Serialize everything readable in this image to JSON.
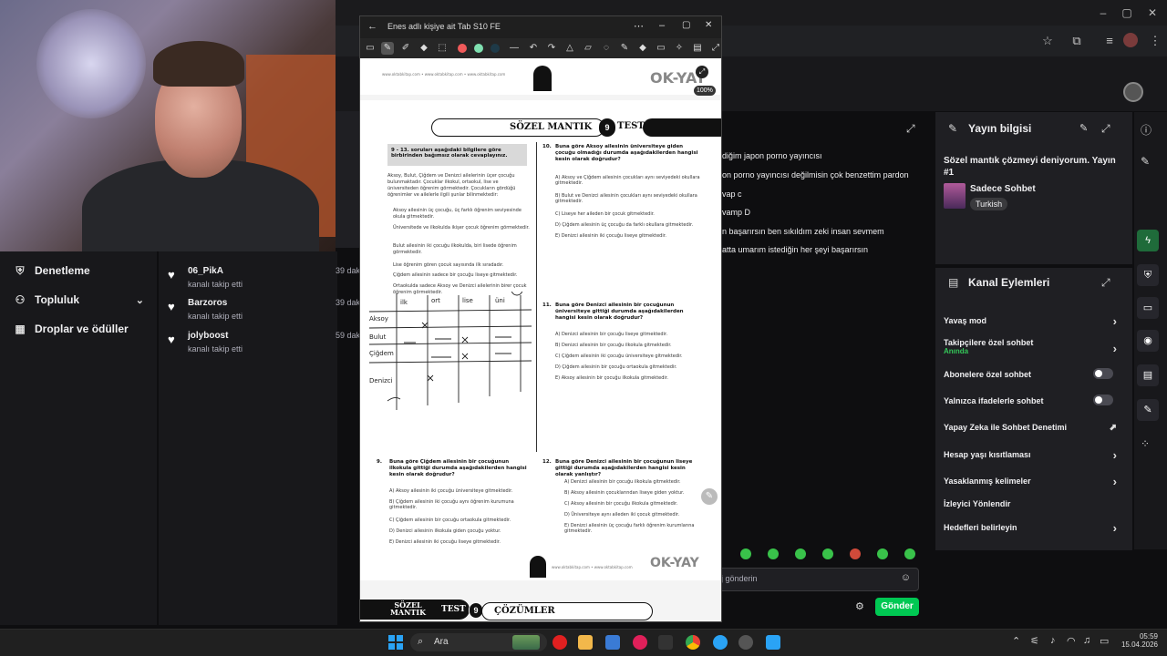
{
  "tablet_window": {
    "title": "Enes adlı kişiye ait Tab S10 FE",
    "zoom": "100%"
  },
  "document": {
    "brand_top": "OK-YAY",
    "brand_bottom": "OK-YAY",
    "header_title": "SÖZEL MANTIK",
    "header_number": "9",
    "header_test": "TEST",
    "footer_title_line1": "SÖZEL",
    "footer_title_line2": "MANTIK",
    "footer_test": "TEST",
    "footer_number": "9",
    "footer_section": "ÇÖZÜMLER",
    "intro_box": "9 - 13. soruları aşağıdaki bilgilere göre birbirinden bağımsız olarak cevaplayınız.",
    "intro_text": "Aksoy, Bulut, Çiğdem ve Denizci ailelerinin üçer çocuğu bulunmaktadır. Çocuklar ilkokul, ortaokul, lise ve üniversiteden öğrenim görmektedir. Çocukların gördüğü öğrenimler ve ailelerle ilgili şunlar bilinmektedir:",
    "bullets": [
      "Aksoy ailesinin üç çocuğu, üç farklı öğrenim seviyesinde okula gitmektedir.",
      "Üniversitede ve ilkokulda ikişer çocuk öğrenim görmektedir.",
      "Bulut ailesinin iki çocuğu ilkokulda, biri lisede öğrenim görmektedir.",
      "Lise öğrenim gören çocuk sayısında ilk sıradadır.",
      "Çiğdem ailesinin sadece bir çocuğu liseye gitmektedir.",
      "Ortaokulda sadece Aksoy ve Denizci ailelerinin birer çocuk öğrenim görmektedir."
    ],
    "grid_rows": [
      "Aksoy",
      "Bulut",
      "Çiğdem",
      "Denizci"
    ],
    "grid_cols": [
      "ilk",
      "ort",
      "lise",
      "üni"
    ],
    "q10": {
      "num": "10.",
      "text": "Buna göre Aksoy ailesinin üniversiteye giden çocuğu olmadığı durumda aşağıdakilerden hangisi kesin olarak doğrudur?",
      "options": [
        "A) Aksoy ve Çiğdem ailesinin çocukları aynı seviyedeki okullara gitmektedir.",
        "B) Bulut ve Denizci ailesinin çocukları aynı seviyedeki okullara gitmektedir.",
        "C) Liseye her aileden bir çocuk gitmektedir.",
        "D) Çiğdem ailesinin üç çocuğu da farklı okullara gitmektedir.",
        "E) Denizci ailesinin iki çocuğu liseye gitmektedir."
      ]
    },
    "q11": {
      "num": "11.",
      "text": "Buna göre Denizci ailesinin bir çocuğunun üniversiteye gittiği durumda aşağıdakilerden hangisi kesin olarak doğrudur?",
      "options": [
        "A) Denizci ailesinin bir çocuğu liseye gitmektedir.",
        "B) Denizci ailesinin bir çocuğu ilkokula gitmektedir.",
        "C) Çiğdem ailesinin iki çocuğu üniversiteye gitmektedir.",
        "D) Çiğdem ailesinin bir çocuğu ortaokula gitmektedir.",
        "E) Aksoy ailesinin bir çocuğu ilkokula gitmektedir."
      ]
    },
    "q9": {
      "num": "9.",
      "text": "Buna göre Çiğdem ailesinin bir çocuğunun ilkokula gittiği durumda aşağıdakilerden hangisi kesin olarak doğrudur?",
      "options": [
        "A) Aksoy ailesinin iki çocuğu üniversiteye gitmektedir.",
        "B) Çiğdem ailesinin iki çocuğu aynı öğrenim kurumuna gitmektedir.",
        "C) Çiğdem ailesinin bir çocuğu ortaokula gitmektedir.",
        "D) Denizci ailesinin ilkokula giden çocuğu yoktur.",
        "E) Denizci ailesinin iki çocuğu liseye gitmektedir."
      ]
    },
    "q12": {
      "num": "12.",
      "text": "Buna göre Denizci ailesinin bir çocuğunun liseye gittiği durumda aşağıdakilerden hangisi kesin olarak yanlıştır?",
      "options": [
        "A) Denizci ailesinin bir çocuğu ilkokula gitmektedir.",
        "B) Aksoy ailesinin çocuklarından liseye giden yoktur.",
        "C) Aksoy ailesinin bir çocuğu ilkokula gitmektedir.",
        "D) Üniversiteye aynı aileden iki çocuk gitmektedir.",
        "E) Denizci ailesinin üç çocuğu farklı öğrenim kurumlarına gitmektedir."
      ]
    }
  },
  "left_nav": {
    "items": [
      {
        "label": "Denetleme",
        "icon": "shield-icon"
      },
      {
        "label": "Topluluk",
        "icon": "people-icon"
      },
      {
        "label": "Droplar ve ödüller",
        "icon": "gift-icon"
      }
    ]
  },
  "followers": [
    {
      "name": "06_PikA",
      "sub": "kanalı takip etti",
      "when": "39 dak"
    },
    {
      "name": "Barzoros",
      "sub": "kanalı takip etti",
      "when": "39 dak"
    },
    {
      "name": "jolyboost",
      "sub": "kanalı takip etti",
      "when": "59 dak"
    }
  ],
  "chat_lines": [
    "diğim japon porno yayıncısı",
    "on porno yayıncısı değilmisin çok benzettim pardon",
    "vap c",
    "vamp D",
    "n başarırsın ben sıkıldım zeki insan sevmem",
    "atta umarım istediğin her şeyi başarırsın"
  ],
  "stream_info": {
    "title": "Yayın bilgisi",
    "stream_title": "Sözel mantık çözmeyi deniyorum. Yayın #1",
    "category": "Sadece Sohbet",
    "tag": "Turkish"
  },
  "channel_actions": {
    "title": "Kanal Eylemleri",
    "rows": [
      {
        "label": "Yavaş mod",
        "control": "chevron"
      },
      {
        "label": "Takipçilere özel sohbet",
        "sub": "Anında",
        "control": "chevron"
      },
      {
        "label": "Abonelere özel sohbet",
        "control": "toggle"
      },
      {
        "label": "Yalnızca ifadelerle sohbet",
        "control": "toggle"
      },
      {
        "label": "Yapay Zeka ile Sohbet Denetimi",
        "control": "external"
      },
      {
        "label": "Hesap yaşı kısıtlaması",
        "control": "chevron"
      },
      {
        "label": "Yasaklanmış kelimeler",
        "control": "chevron"
      },
      {
        "label": "İzleyici Yönlendir",
        "control": "none"
      },
      {
        "label": "Hedefleri belirleyin",
        "control": "chevron"
      }
    ]
  },
  "chat_footer": {
    "placeholder": "Bir mesaj gönderin",
    "visible_placeholder": "j gönderin",
    "send_label": "Gönder"
  },
  "taskbar": {
    "search_label": "Ara",
    "time": "05:59",
    "date": "15.04.2026"
  },
  "colors": {
    "twitch_bg": "#0e0e10",
    "panel_bg": "#1f1f23",
    "send_green": "#00c853",
    "accent_green": "#1f6b3a"
  }
}
